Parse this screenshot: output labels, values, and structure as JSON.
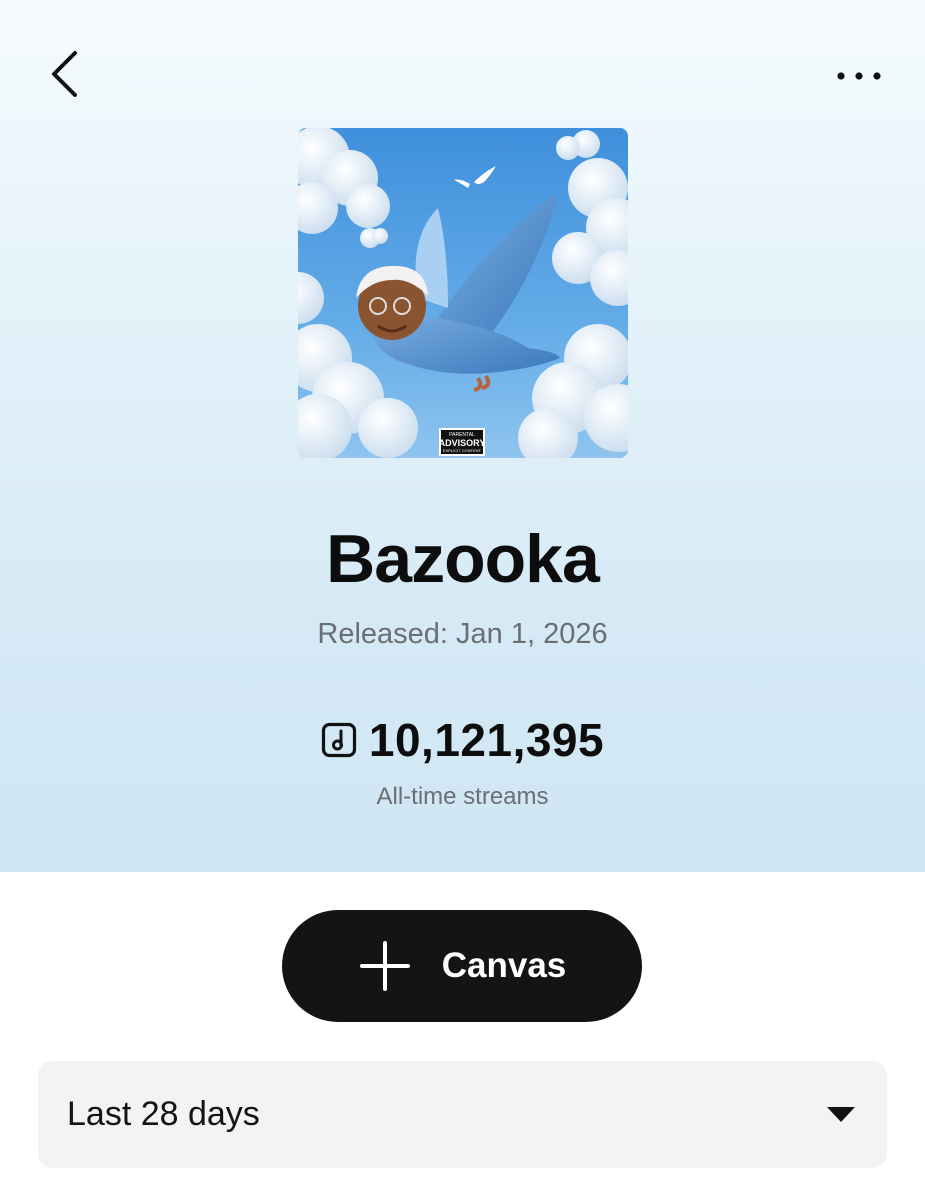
{
  "header": {
    "back_icon": "chevron-left-icon",
    "more_icon": "more-horizontal-icon"
  },
  "release": {
    "title": "Bazooka",
    "released_text": "Released: Jan 1, 2026",
    "streams_icon": "music-note-square-icon",
    "streams_count": "10,121,395",
    "streams_label": "All-time streams"
  },
  "cover": {
    "advisory_line1": "PARENTAL",
    "advisory_line2": "ADVISORY",
    "advisory_line3": "EXPLICIT CONTENT"
  },
  "actions": {
    "canvas_icon": "plus-icon",
    "canvas_label": "Canvas"
  },
  "filter": {
    "selected_range": "Last 28 days",
    "dropdown_icon": "caret-down-icon"
  },
  "colors": {
    "hero_top": "#f6fbfe",
    "hero_bottom": "#cfe6f4",
    "button_bg": "#141414",
    "select_bg": "#f3f3f3",
    "secondary_text": "#6b6f73"
  }
}
